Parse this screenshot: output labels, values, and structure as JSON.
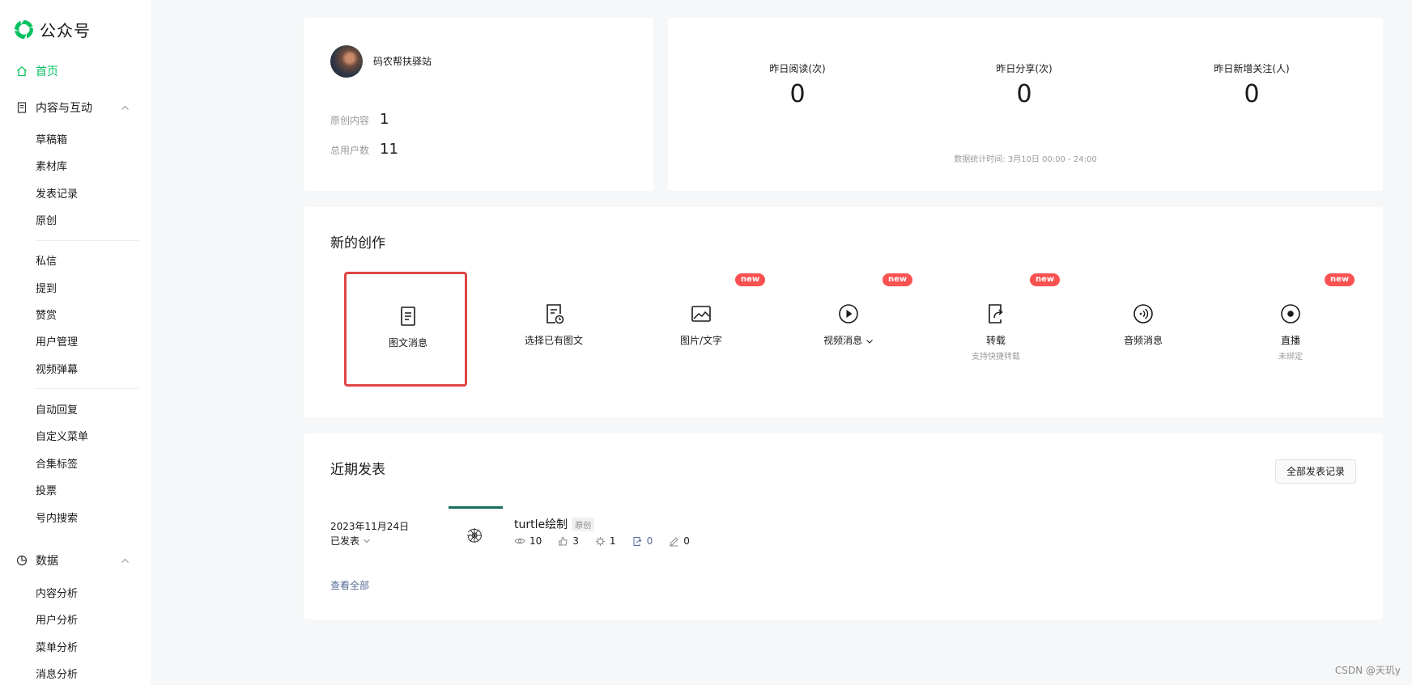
{
  "app": {
    "title": "公众号"
  },
  "sidebar": {
    "home": "首页",
    "content_group": "内容与互动",
    "content_items": [
      "草稿箱",
      "素材库",
      "发表记录",
      "原创"
    ],
    "interact_items": [
      "私信",
      "提到",
      "赞赏",
      "用户管理",
      "视频弹幕"
    ],
    "tool_items": [
      "自动回复",
      "自定义菜单",
      "合集标签",
      "投票",
      "号内搜索"
    ],
    "data_group": "数据",
    "data_items": [
      "内容分析",
      "用户分析",
      "菜单分析",
      "消息分析"
    ]
  },
  "account": {
    "name": "码农帮扶驿站",
    "original_label": "原创内容",
    "original_value": "1",
    "users_label": "总用户数",
    "users_value": "11"
  },
  "stats": {
    "reads_label": "昨日阅读(次)",
    "reads_value": "0",
    "shares_label": "昨日分享(次)",
    "shares_value": "0",
    "follows_label": "昨日新增关注(人)",
    "follows_value": "0",
    "note": "数据统计时间: 3月10日 00:00 - 24:00"
  },
  "create": {
    "title": "新的创作",
    "items": [
      {
        "name": "图文消息",
        "icon": "document-icon"
      },
      {
        "name": "选择已有图文",
        "icon": "document-clock-icon"
      },
      {
        "name": "图片/文字",
        "icon": "image-icon",
        "badge": "new"
      },
      {
        "name": "视频消息",
        "icon": "play-icon",
        "badge": "new"
      },
      {
        "name": "转载",
        "sub": "支持快捷转载",
        "icon": "share-doc-icon",
        "badge": "new"
      },
      {
        "name": "音频消息",
        "icon": "audio-icon"
      },
      {
        "name": "直播",
        "sub": "未绑定",
        "icon": "live-icon",
        "badge": "new"
      }
    ]
  },
  "recent": {
    "title": "近期发表",
    "all_button": "全部发表记录",
    "post": {
      "date": "2023年11月24日",
      "status": "已发表",
      "title": "turtle绘制",
      "tag": "原创",
      "reads": "10",
      "likes": "3",
      "wow": "1",
      "shares": "0",
      "comments": "0"
    },
    "view_all": "查看全部"
  },
  "watermark": "CSDN @天玑y",
  "colors": {
    "brand": "#07c160",
    "badge": "#fa5151",
    "link": "#576b95",
    "selected_border": "#e04545"
  }
}
